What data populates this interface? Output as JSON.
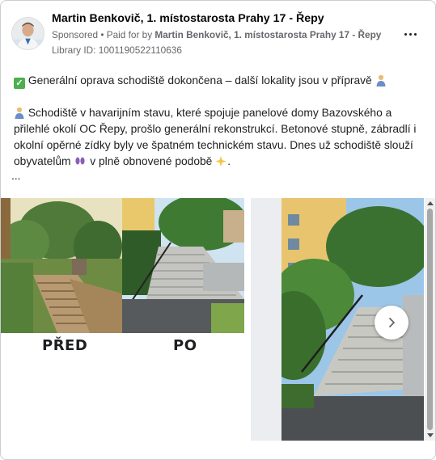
{
  "post": {
    "author": "Martin Benkovič, 1. místostarosta Prahy 17 - Řepy",
    "sponsored_label": "Sponsored",
    "paid_for_prefix": " • Paid for by ",
    "paid_for_by": "Martin Benkovič, 1. místostarosta Prahy 17 - Řepy",
    "library_id": "Library ID: 1001190522110636",
    "more_icon": "more-horizontal-icon"
  },
  "content": {
    "line1": " Generální oprava schodiště dokončena – další lokality jsou v přípravě ",
    "para_part1": " Schodiště v havarijním stavu, které spojuje panelové domy Bazovského a přilehlé okolí OC Řepy, prošlo generální rekonstrukcí. Betonové stupně, zábradlí i okolní opěrné zídky byly ve špatném technickém stavu. Dnes už schodiště slouží obyvatelům ",
    "para_part2": " v plně obnovené podobě ",
    "para_end": ".",
    "ellipsis": "..."
  },
  "carousel": {
    "card1_before_label": "PŘED",
    "card1_after_label": "PO",
    "next_icon": "chevron-right-icon"
  },
  "colors": {
    "text": "#1c1e21",
    "meta": "#65676b",
    "check_green": "#4caf50",
    "gray_gap": "#ebedf0"
  }
}
